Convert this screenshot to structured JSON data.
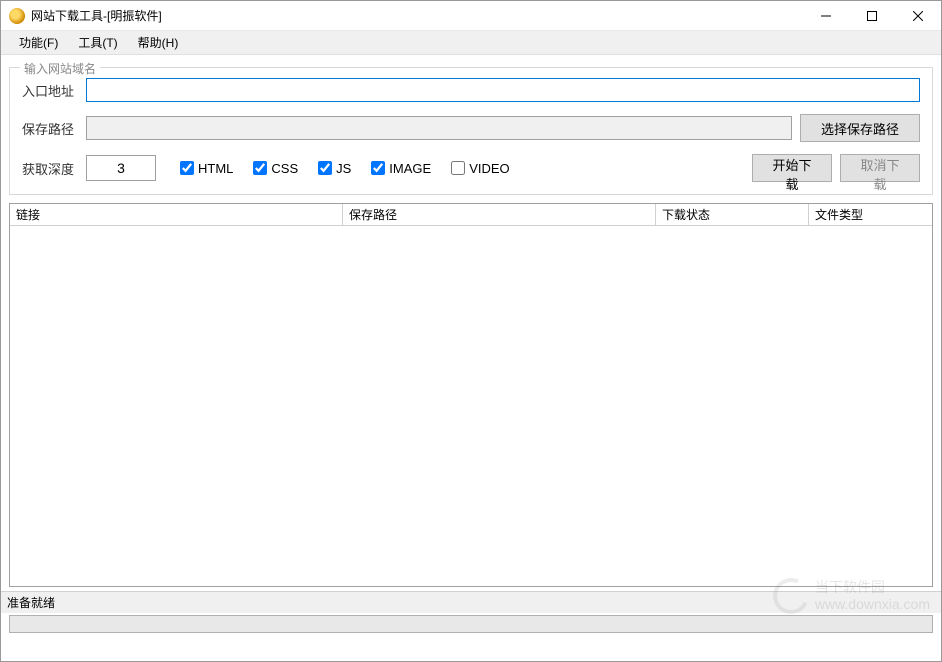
{
  "window": {
    "title": "网站下载工具-[明振软件]"
  },
  "menu": {
    "function": "功能(F)",
    "tools": "工具(T)",
    "help": "帮助(H)"
  },
  "group": {
    "legend": "输入网站域名",
    "url_label": "入口地址",
    "url_value": "",
    "savepath_label": "保存路径",
    "savepath_value": "",
    "select_path_btn": "选择保存路径",
    "depth_label": "获取深度",
    "depth_value": "3",
    "checkboxes": {
      "html": {
        "label": "HTML",
        "checked": true
      },
      "css": {
        "label": "CSS",
        "checked": true
      },
      "js": {
        "label": "JS",
        "checked": true
      },
      "image": {
        "label": "IMAGE",
        "checked": true
      },
      "video": {
        "label": "VIDEO",
        "checked": false
      }
    },
    "start_btn": "开始下载",
    "cancel_btn": "取消下载"
  },
  "table": {
    "headers": {
      "link": "链接",
      "savepath": "保存路径",
      "status": "下载状态",
      "filetype": "文件类型"
    }
  },
  "statusbar": {
    "text": "准备就绪"
  },
  "watermark": {
    "name": "当下软件园",
    "url": "www.downxia.com"
  }
}
